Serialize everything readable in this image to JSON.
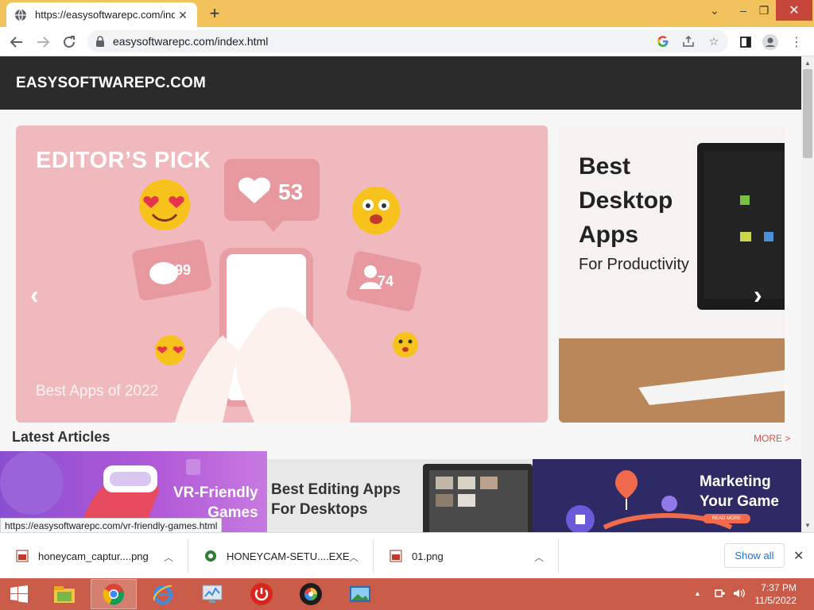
{
  "browser": {
    "tab_title": "https://easysoftwarepc.com/inde",
    "url": "easysoftwarepc.com/index.html",
    "status_url": "https://easysoftwarepc.com/vr-friendly-games.html",
    "icons": [
      "globe-icon",
      "close-icon",
      "plus-icon",
      "chevron-down-icon",
      "back-icon",
      "forward-icon",
      "reload-icon",
      "lock-icon",
      "google-icon",
      "share-icon",
      "star-icon",
      "side-panel-icon",
      "profile-icon",
      "menu-icon"
    ],
    "colors": {
      "titlebar": "#f2c35c",
      "close_button": "#c7463c"
    }
  },
  "site": {
    "logo": "EASYSOFTWAREPC.COM",
    "slider": {
      "main": {
        "heading": "EDITOR’S PICK",
        "caption": "Best Apps of 2022",
        "badge_likes": "53",
        "badge_comments": "99",
        "badge_followers": "74"
      },
      "second": {
        "heading_lines": [
          "Best",
          "Desktop",
          "Apps"
        ],
        "subheading": "For Productivity"
      }
    },
    "latest": {
      "title": "Latest Articles",
      "more": "MORE >",
      "articles": [
        {
          "title_lines": [
            "VR-Friendly",
            "Games"
          ]
        },
        {
          "title_lines": [
            "Best Editing Apps",
            "For Desktops"
          ]
        },
        {
          "title_lines": [
            "Marketing",
            "Your Game"
          ],
          "button": "READ MORE"
        }
      ]
    },
    "colors": {
      "header": "#2b2b2b",
      "slide_pink": "#f0b9bd",
      "more_link": "#d9534f"
    }
  },
  "downloads": {
    "items": [
      {
        "name": "honeycam_captur....png",
        "icon": "image-file-icon"
      },
      {
        "name": "HONEYCAM-SETU....EXE",
        "icon": "installer-icon"
      },
      {
        "name": "01.png",
        "icon": "image-file-icon"
      }
    ],
    "show_all": "Show all"
  },
  "taskbar": {
    "apps": [
      "start-button",
      "file-explorer-icon",
      "chrome-icon",
      "internet-explorer-icon",
      "task-manager-icon",
      "power-icon",
      "color-wheel-icon",
      "photo-viewer-icon"
    ],
    "time": "7:37 PM",
    "date": "11/5/2022",
    "colors": {
      "background": "#c85c48"
    }
  }
}
